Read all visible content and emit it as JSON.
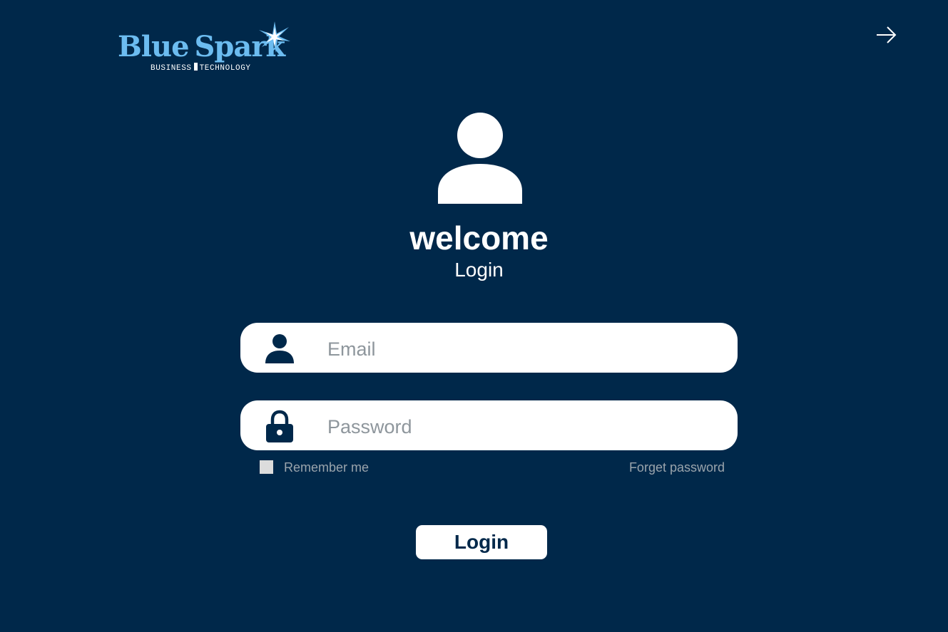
{
  "brand": {
    "name_part1": "Blue",
    "name_part2": "Spark",
    "tagline_left": "BUSINESS",
    "tagline_right": "TECHNOLOGY",
    "logo_color": "#6cbcf0"
  },
  "header": {
    "exit_icon": "arrow-right-icon"
  },
  "hero": {
    "avatar_icon": "user-avatar-icon",
    "title": "welcome",
    "subtitle": "Login"
  },
  "form": {
    "email": {
      "icon": "user-icon",
      "placeholder": "Email",
      "value": ""
    },
    "password": {
      "icon": "lock-icon",
      "placeholder": "Password",
      "value": ""
    },
    "remember_label": "Remember me",
    "remember_checked": false,
    "forgot_label": "Forget password",
    "submit_label": "Login"
  },
  "colors": {
    "background": "#00284a",
    "field_background": "#ffffff",
    "muted_text": "#9aa4ac",
    "placeholder_text": "#8e969c"
  }
}
